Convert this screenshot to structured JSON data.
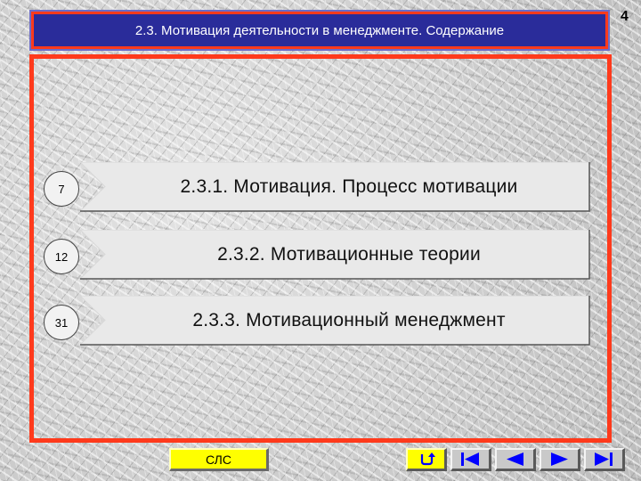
{
  "header": {
    "title": "2.3. Мотивация деятельности в менеджменте. Содержание",
    "page_number": "4"
  },
  "items": [
    {
      "page": "7",
      "label": "2.3.1. Мотивация. Процесс мотивации"
    },
    {
      "page": "12",
      "label": "2.3.2. Мотивационные теории"
    },
    {
      "page": "31",
      "label": "2.3.3. Мотивационный менеджмент"
    }
  ],
  "footer": {
    "cls_label": "СЛС",
    "nav_icons": [
      "return-icon",
      "first-page-icon",
      "previous-icon",
      "next-icon",
      "last-page-icon"
    ]
  },
  "colors": {
    "title_bg": "#2a2c9a",
    "frame_border": "#ff3a1c",
    "cls_button_bg": "#ffff00",
    "nav_arrow": "#0000ff"
  }
}
